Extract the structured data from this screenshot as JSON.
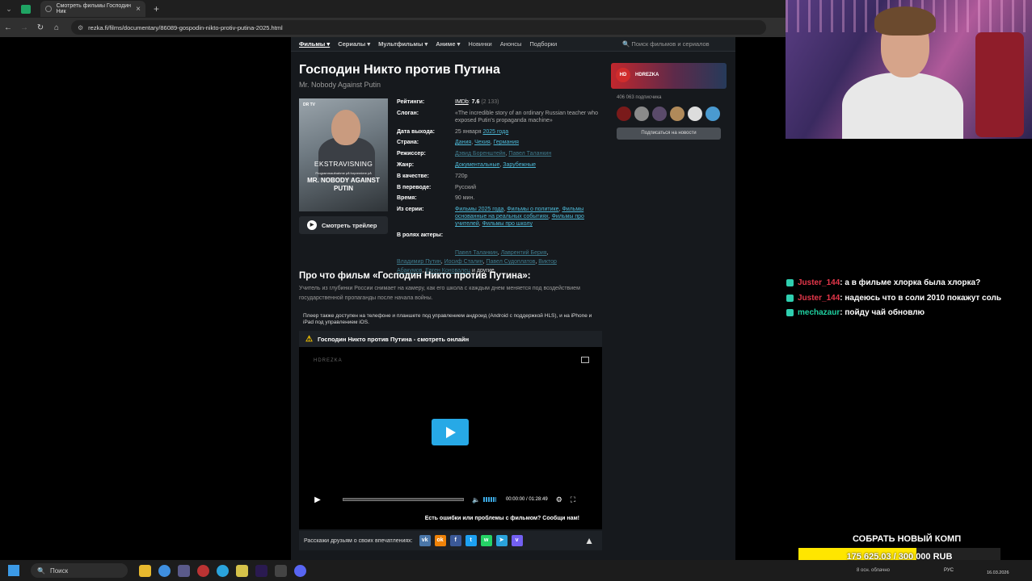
{
  "browser": {
    "tab_title": "Смотреть фильмы Господин Ник",
    "url": "rezka.fi/films/documentary/86089-gospodin-nikto-protiv-putina-2025.html"
  },
  "site_nav": {
    "items": [
      "Фильмы ▾",
      "Сериалы ▾",
      "Мультфильмы ▾",
      "Аниме ▾",
      "Новинки",
      "Анонсы",
      "Подборки"
    ],
    "search_placeholder": "🔍 Поиск фильмов и сериалов"
  },
  "film": {
    "title": "Господин Никто против Путина",
    "original_title": "Mr. Nobody Against Putin",
    "poster": {
      "top_logo": "DR TV",
      "line1": "EKSTRAVISNING",
      "line2": "Programmaufnahme på forpremiere på",
      "line3": "MR. NOBODY AGAINST PUTIN"
    },
    "trailer_label": "Смотреть трейлер",
    "info": {
      "rating_label": "Рейтинги:",
      "imdb": "IMDb",
      "imdb_score": "7.6",
      "imdb_votes": "(2 133)",
      "slogan_label": "Слоган:",
      "slogan": "«The incredible story of an ordinary Russian teacher who exposed Putin's propaganda machine»",
      "release_label": "Дата выхода:",
      "release_date": "25 января",
      "release_year": "2025 года",
      "country_label": "Страна:",
      "countries": [
        "Дания",
        "Чехия",
        "Германия"
      ],
      "director_label": "Режиссер:",
      "directors": [
        "Дэвид Боренштейн",
        "Павел Таланкин"
      ],
      "genre_label": "Жанр:",
      "genres": [
        "Документальные",
        "Зарубежные"
      ],
      "quality_label": "В качестве:",
      "quality": "720p",
      "translation_label": "В переводе:",
      "translation": "Русский",
      "duration_label": "Время:",
      "duration": "90 мин.",
      "series_label": "Из серии:",
      "series": [
        "Фильмы 2025 года",
        "Фильмы о политике",
        "Фильмы основанные на реальных событиях",
        "Фильмы про учителей",
        "Фильмы про школу"
      ],
      "cast_label": "В ролях актеры:",
      "cast": [
        "Павел Таланкин",
        "Лаврентий Берия",
        "Владимир Путин",
        "Иосиф Сталин",
        "Павел Судоплатов",
        "Виктор Абакумов",
        "Евген Коновалец"
      ],
      "cast_more": "и другие"
    },
    "about_heading": "Про что фильм «Господин Никто против Путина»:",
    "about_text": "Учитель из глубинки России снимает на камеру, как его школа с каждым днем меняется под воздействием государственной пропаганды после начала войны."
  },
  "player": {
    "note": "Плеер также доступен на телефоне и планшете под управлением андроид (Android с поддержкой HLS), и на iPhone и iPad под управлением iOS.",
    "heading": "Господин Никто против Путина - смотреть онлайн",
    "brand": "HDREZKA",
    "time": "00:00:00 / 01:28:49",
    "progress": 0,
    "problem_text": "Есть ошибки или проблемы с фильмом? Сообщи нам!",
    "share_label": "Расскажи друзьям о своих впечатлениях:",
    "share_buttons": [
      {
        "icon": "vk-icon",
        "glyph": "vk",
        "color": "#4a76a8"
      },
      {
        "icon": "ok-icon",
        "glyph": "ok",
        "color": "#ee8208"
      },
      {
        "icon": "facebook-icon",
        "glyph": "f",
        "color": "#3b5998"
      },
      {
        "icon": "twitter-icon",
        "glyph": "t",
        "color": "#1da1f2"
      },
      {
        "icon": "whatsapp-icon",
        "glyph": "w",
        "color": "#25d366"
      },
      {
        "icon": "telegram-icon",
        "glyph": "➤",
        "color": "#2aa3dc"
      },
      {
        "icon": "viber-icon",
        "glyph": "v",
        "color": "#7360f2"
      }
    ]
  },
  "sidebar": {
    "banner_name": "HDREZKA",
    "banner_badge": "HD",
    "subscribers": "406 063 подписчика",
    "subscribe_button": "Подписаться на новости"
  },
  "chat": [
    {
      "user": "Juster_144",
      "text": ": а в фильме хлорка была хлорка?",
      "user_color": "u1"
    },
    {
      "user": "Juster_144",
      "text": ": надеюсь что в соли 2010 покажут соль",
      "user_color": "u1"
    },
    {
      "user": "mechazaur",
      "text": ": пойду чай обновлю",
      "user_color": "u2"
    }
  ],
  "goal": {
    "title": "СОБРАТЬ НОВЫЙ КОМП",
    "text": "175 625.03 / 300 000 RUB",
    "fraction": 0.585
  },
  "taskbar": {
    "search": "Поиск",
    "weather": "8 осн. облачно",
    "lang": "РУС",
    "date": "16.03.2026"
  },
  "colors": {
    "accent": "#27a9e6",
    "link": "#4db8d6",
    "goal": "#ffe600",
    "chat_user1": "#e5374a",
    "chat_user2": "#1fd0a0"
  }
}
